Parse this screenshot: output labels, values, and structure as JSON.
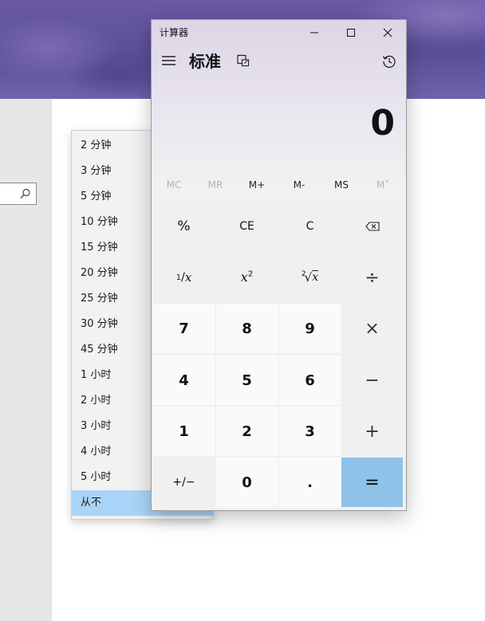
{
  "dropdown": {
    "items": [
      "2 分钟",
      "3 分钟",
      "5 分钟",
      "10 分钟",
      "15 分钟",
      "20 分钟",
      "25 分钟",
      "30 分钟",
      "45 分钟",
      "1 小时",
      "2 小时",
      "3 小时",
      "4 小时",
      "5 小时",
      "从不"
    ],
    "selected_index": 14
  },
  "calculator": {
    "window_title": "计算器",
    "mode": "标准",
    "display_value": "0",
    "memory": [
      "MC",
      "MR",
      "M+",
      "M-",
      "MS",
      "M˅"
    ],
    "keys": {
      "percent": "%",
      "ce": "CE",
      "clear": "C",
      "reciprocal_num": "1",
      "reciprocal_den": "x",
      "square_base": "x",
      "square_exp": "2",
      "sqrt_index": "2",
      "sqrt_x": "x",
      "divide": "÷",
      "seven": "7",
      "eight": "8",
      "nine": "9",
      "multiply": "×",
      "four": "4",
      "five": "5",
      "six": "6",
      "minus": "−",
      "one": "1",
      "two": "2",
      "three": "3",
      "plus": "+",
      "negate": "+/−",
      "zero": "0",
      "decimal": ".",
      "equals": "="
    }
  },
  "colors": {
    "accent_equals": "#8fc2e8",
    "dropdown_selected": "#a9d4f7"
  }
}
